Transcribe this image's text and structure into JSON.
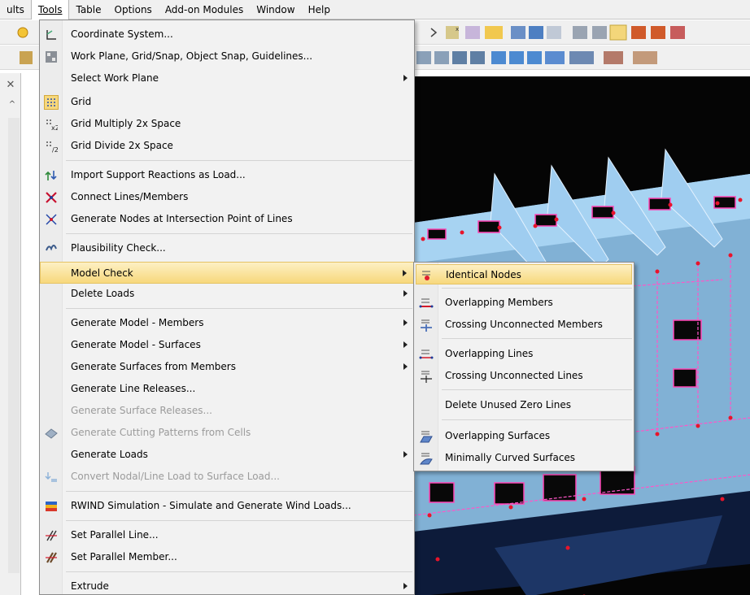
{
  "menubar": {
    "items": [
      "ults",
      "Tools",
      "Table",
      "Options",
      "Add-on Modules",
      "Window",
      "Help"
    ]
  },
  "tools_menu": {
    "items": [
      {
        "label": "Coordinate System...",
        "icon": "coordinate-system-icon",
        "enabled": true,
        "submenu": false
      },
      {
        "label": "Work Plane, Grid/Snap, Object Snap, Guidelines...",
        "icon": "work-plane-icon",
        "enabled": true,
        "submenu": false
      },
      {
        "label": "Select Work Plane",
        "icon": "",
        "enabled": true,
        "submenu": true
      },
      {
        "label": "Grid",
        "icon": "grid-icon",
        "enabled": true,
        "submenu": false
      },
      {
        "label": "Grid Multiply 2x Space",
        "icon": "grid-multiply-icon",
        "enabled": true,
        "submenu": false
      },
      {
        "label": "Grid Divide 2x Space",
        "icon": "grid-divide-icon",
        "enabled": true,
        "submenu": false
      },
      {
        "label": "Import Support Reactions as Load...",
        "icon": "import-reactions-icon",
        "enabled": true,
        "submenu": false
      },
      {
        "label": "Connect Lines/Members",
        "icon": "connect-lines-icon",
        "enabled": true,
        "submenu": false
      },
      {
        "label": "Generate Nodes at Intersection Point of Lines",
        "icon": "intersection-nodes-icon",
        "enabled": true,
        "submenu": false
      },
      {
        "label": "Plausibility Check...",
        "icon": "plausibility-check-icon",
        "enabled": true,
        "submenu": false
      },
      {
        "label": "Model Check",
        "icon": "",
        "enabled": true,
        "submenu": true,
        "highlighted": true
      },
      {
        "label": "Delete Loads",
        "icon": "",
        "enabled": true,
        "submenu": true
      },
      {
        "label": "Generate Model - Members",
        "icon": "",
        "enabled": true,
        "submenu": true
      },
      {
        "label": "Generate Model - Surfaces",
        "icon": "",
        "enabled": true,
        "submenu": true
      },
      {
        "label": "Generate Surfaces from Members",
        "icon": "",
        "enabled": true,
        "submenu": true
      },
      {
        "label": "Generate Line Releases...",
        "icon": "",
        "enabled": true,
        "submenu": false
      },
      {
        "label": "Generate Surface Releases...",
        "icon": "",
        "enabled": false,
        "submenu": false
      },
      {
        "label": "Generate Cutting Patterns from Cells",
        "icon": "cutting-pattern-icon",
        "enabled": false,
        "submenu": false
      },
      {
        "label": "Generate Loads",
        "icon": "",
        "enabled": true,
        "submenu": true
      },
      {
        "label": "Convert Nodal/Line Load to Surface Load...",
        "icon": "convert-load-icon",
        "enabled": false,
        "submenu": false
      },
      {
        "label": "RWIND Simulation - Simulate and Generate Wind Loads...",
        "icon": "rwind-icon",
        "enabled": true,
        "submenu": false
      },
      {
        "label": "Set Parallel Line...",
        "icon": "parallel-line-icon",
        "enabled": true,
        "submenu": false
      },
      {
        "label": "Set Parallel Member...",
        "icon": "parallel-member-icon",
        "enabled": true,
        "submenu": false
      },
      {
        "label": "Extrude",
        "icon": "",
        "enabled": true,
        "submenu": true
      }
    ]
  },
  "model_check_submenu": {
    "items": [
      {
        "label": "Identical Nodes",
        "icon": "identical-nodes-icon",
        "highlighted": true
      },
      {
        "label": "Overlapping Members",
        "icon": "overlapping-members-icon"
      },
      {
        "label": "Crossing Unconnected Members",
        "icon": "crossing-members-icon"
      },
      {
        "label": "Overlapping Lines",
        "icon": "overlapping-lines-icon"
      },
      {
        "label": "Crossing Unconnected Lines",
        "icon": "crossing-lines-icon"
      },
      {
        "label": "Delete Unused Zero Lines",
        "icon": ""
      },
      {
        "label": "Overlapping Surfaces",
        "icon": "overlapping-surfaces-icon"
      },
      {
        "label": "Minimally Curved Surfaces",
        "icon": "curved-surfaces-icon"
      }
    ]
  },
  "colors": {
    "highlight": "#f7d87c",
    "viewport_bg": "#050505",
    "model_blue": "#8fc4ec",
    "node_red": "#e8142a"
  }
}
